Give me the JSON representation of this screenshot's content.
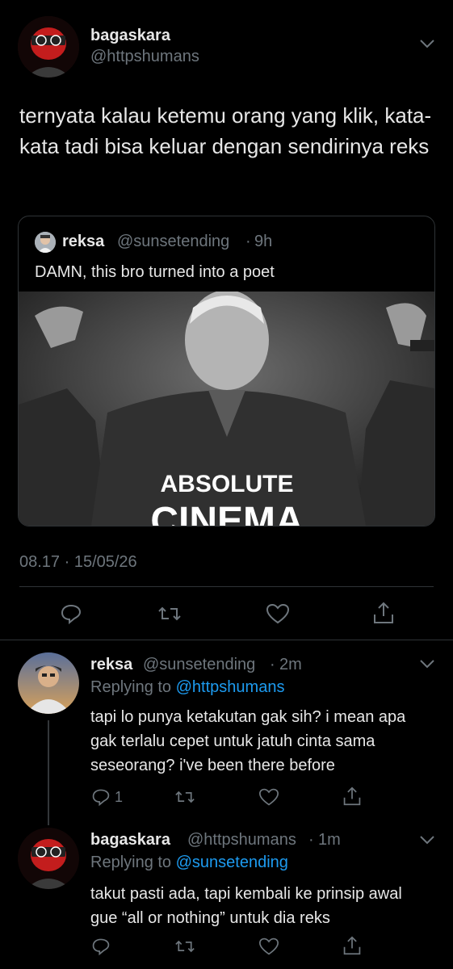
{
  "main_tweet": {
    "author_name": "bagaskara",
    "author_handle": "@httpshumans",
    "text": "ternyata kalau ketemu orang yang klik, kata-kata tadi bisa keluar dengan sendirinya reks",
    "quote": {
      "author_name": "reksa",
      "author_handle": "@sunsetending",
      "separator": "·",
      "time": "9h",
      "text": "DAMN, this bro turned into a poet",
      "image_caption_line1": "ABSOLUTE",
      "image_caption_line2": "CINEMA"
    },
    "timestamp": "08.17 · 15/05/26",
    "actions": [
      "reply-icon",
      "retweet-icon",
      "like-icon",
      "share-icon"
    ]
  },
  "reply1": {
    "author_name": "reksa",
    "author_handle": "@sunsetending",
    "separator": "·",
    "time": "2m",
    "replying_prefix": "Replying to",
    "replying_to": "@httpshumans",
    "text": "tapi lo punya ketakutan gak sih? i mean apa gak terlalu cepet untuk jatuh cinta sama seseorang? i've been there before",
    "reply_count": "1"
  },
  "reply2": {
    "author_name": "bagaskara",
    "author_handle": "@httpshumans",
    "separator": "·",
    "time": "1m",
    "replying_prefix": "Replying to",
    "replying_to": "@sunsetending",
    "text": "takut pasti ada, tapi kembali ke prinsip awal gue “all or nothing” untuk dia reks"
  },
  "colors": {
    "background": "#000000",
    "link": "#1d9bf0",
    "muted": "#6e767d",
    "text": "#d9d9d9"
  }
}
